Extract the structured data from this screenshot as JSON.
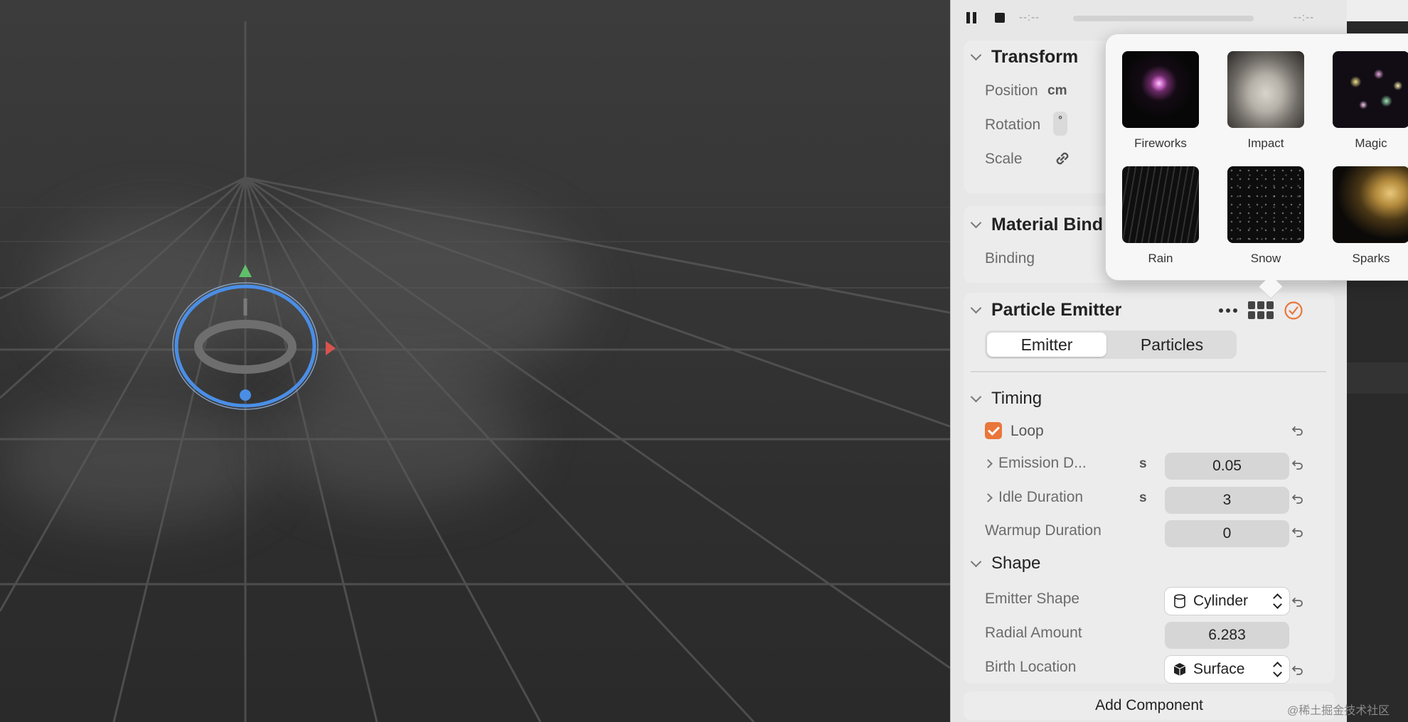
{
  "playback": {
    "time_start": "--:--",
    "time_end": "--:--",
    "pause_icon": "pause-icon",
    "stop_icon": "stop-icon"
  },
  "transform": {
    "title": "Transform",
    "position": {
      "label": "Position",
      "unit": "cm"
    },
    "rotation": {
      "label": "Rotation",
      "unit": "°"
    },
    "scale": {
      "label": "Scale",
      "icon": "link-icon"
    }
  },
  "material_bindings": {
    "title": "Material Bind",
    "binding_label": "Binding"
  },
  "particle_emitter": {
    "title": "Particle Emitter",
    "more_icon": "ellipsis-icon",
    "presets_icon": "grid-icon",
    "enabled_icon": "checkmark-circle-icon",
    "tabs": [
      {
        "label": "Emitter",
        "active": true
      },
      {
        "label": "Particles",
        "active": false
      }
    ]
  },
  "timing": {
    "title": "Timing",
    "loop": {
      "label": "Loop",
      "checked": true
    },
    "emission_duration": {
      "label": "Emission D...",
      "unit": "s",
      "value": "0.05"
    },
    "idle_duration": {
      "label": "Idle Duration",
      "unit": "s",
      "value": "3"
    },
    "warmup_duration": {
      "label": "Warmup Duration",
      "value": "0"
    }
  },
  "shape": {
    "title": "Shape",
    "emitter_shape": {
      "label": "Emitter Shape",
      "value": "Cylinder",
      "icon": "cylinder-icon"
    },
    "radial_amount": {
      "label": "Radial Amount",
      "value": "6.283"
    },
    "birth_location": {
      "label": "Birth Location",
      "value": "Surface",
      "icon": "cube-icon"
    }
  },
  "add_component_label": "Add Component",
  "presets": [
    {
      "label": "Fireworks"
    },
    {
      "label": "Impact"
    },
    {
      "label": "Magic"
    },
    {
      "label": "Rain"
    },
    {
      "label": "Snow"
    },
    {
      "label": "Sparks"
    }
  ],
  "watermark": "@稀土掘金技术社区",
  "colors": {
    "accent": "#e9763a",
    "gizmo_blue": "#4a8ee6",
    "gizmo_green": "#5fbf6a",
    "gizmo_red": "#d9534f"
  }
}
